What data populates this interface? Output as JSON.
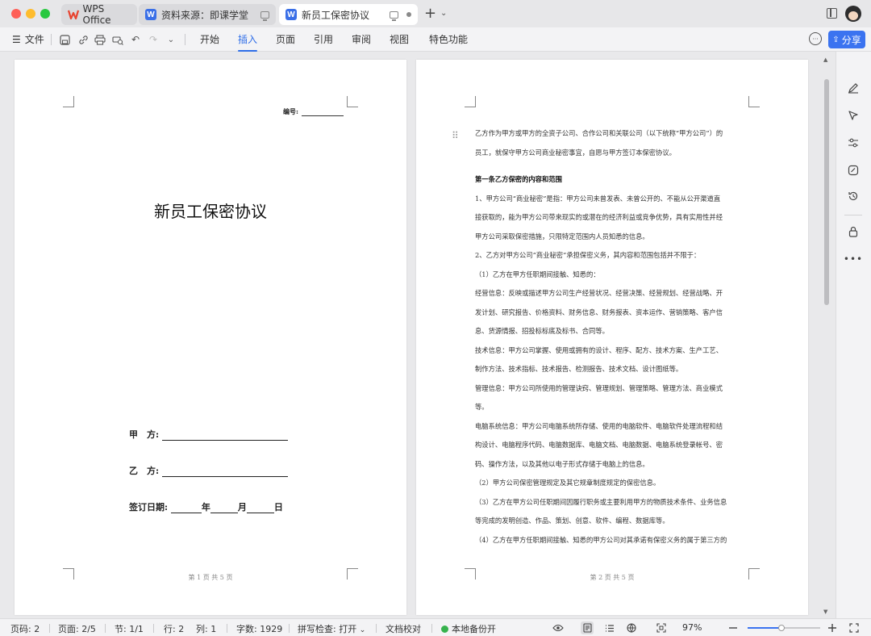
{
  "titlebar": {
    "tabs": [
      {
        "label": "WPS Office"
      },
      {
        "label": "资料来源：即课学堂"
      },
      {
        "label": "新员工保密协议"
      }
    ]
  },
  "menubar": {
    "file_label": "文件",
    "ribbon_tabs": [
      "开始",
      "插入",
      "页面",
      "引用",
      "审阅",
      "视图",
      "特色功能"
    ],
    "active_tab": "插入",
    "share_label": "分享"
  },
  "page1": {
    "serial_label": "编号:",
    "title": "新员工保密协议",
    "party_a_label": "甲　方:",
    "party_b_label": "乙　方:",
    "sign_date_label": "签订日期:",
    "year_label": "年",
    "month_label": "月",
    "day_label": "日",
    "page_number": "第 1 页 共 5 页"
  },
  "page2": {
    "lines": [
      "乙方作为甲方或甲方的全资子公司、合作公司和关联公司（以下统称“甲方公司”）的",
      "员工，就保守甲方公司商业秘密事宜，自愿与甲方签订本保密协议。",
      "",
      "第一条乙方保密的内容和范围",
      "1、甲方公司“商业秘密”是指：甲方公司未曾发表、未曾公开的、不能从公开渠道直",
      "接获取的，能为甲方公司带来现实的或潜在的经济利益或竞争优势，具有实用性并经",
      "甲方公司采取保密措施，只限特定范围内人员知悉的信息。",
      "2、乙方对甲方公司“商业秘密”承担保密义务，其内容和范围包括并不限于：",
      "（1）乙方在甲方任职期间接触、知悉的：",
      "经营信息：反映或描述甲方公司生产经营状况、经营决策、经营规划、经营战略、开",
      "发计划、研究报告、价格资料、财务信息、财务报表、资本运作、营销策略、客户信",
      "息、货源情报、招投标标底及标书、合同等。",
      "技术信息：甲方公司掌握、使用或拥有的设计、程序、配方、技术方案、生产工艺、",
      "制作方法、技术指标、技术报告、检测报告、技术文档、设计图纸等。",
      "管理信息：甲方公司所使用的管理诀窍、管理规划、管理策略、管理方法、商业模式",
      "等。",
      "电脑系统信息：甲方公司电脑系统所存储、使用的电脑软件、电脑软件处理流程和结",
      "构设计、电脑程序代码、电脑数据库、电脑文档、电脑数据、电脑系统登录帐号、密",
      "码、操作方法，以及其他以电子形式存储于电脑上的信息。",
      "（2）甲方公司保密管理规定及其它规章制度规定的保密信息。",
      "（3）乙方在甲方公司任职期间因履行职务或主要利用甲方的物质技术条件、业务信息",
      "等完成的发明创造、作品、策划、创意、软件、编程、数据库等。",
      "（4）乙方在甲方任职期间接触、知悉的甲方公司对其承诺有保密义务的属于第三方的"
    ],
    "page_number": "第 2 页 共 5 页"
  },
  "statusbar": {
    "page_code": "页码: 2",
    "page": "页面: 2/5",
    "section": "节: 1/1",
    "row": "行: 2",
    "col": "列: 1",
    "word_count": "字数: 1929",
    "spell_check": "拼写检查: 打开",
    "proofread": "文档校对",
    "backup": "本地备份开",
    "zoom": "97%"
  },
  "zoom_fraction": 0.47,
  "colors": {
    "accent": "#2f6ee8",
    "share_button": "#3b73f0",
    "backup_ok": "#37b24d"
  }
}
